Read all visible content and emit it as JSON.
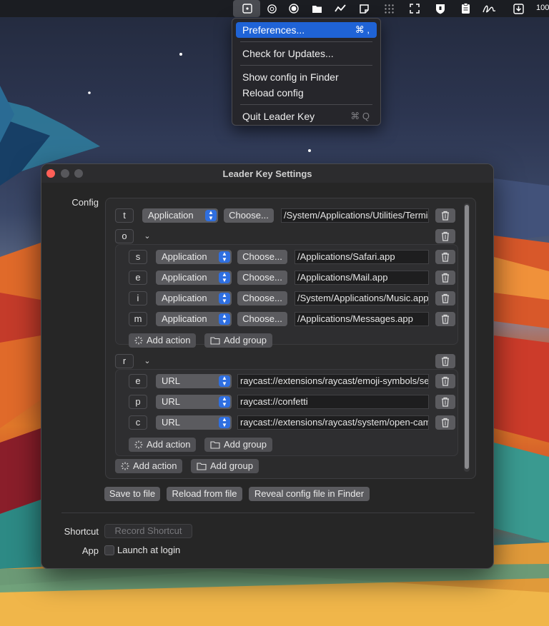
{
  "menubar": {
    "icons": [
      "leader-key-icon",
      "chatgpt-icon",
      "record-icon",
      "folder-icon",
      "activity-icon",
      "sticker-icon",
      "grid-icon",
      "fullscreen-icon",
      "shield-icon",
      "clipboard-icon",
      "signature-icon",
      "download-icon"
    ],
    "right_text": "100"
  },
  "menu": {
    "items": [
      {
        "label": "Preferences...",
        "shortcut": "⌘ ,"
      },
      {
        "label": "Check for Updates..."
      },
      {
        "label": "Show config in Finder"
      },
      {
        "label": "Reload config"
      },
      {
        "label": "Quit Leader Key",
        "shortcut": "⌘ Q"
      }
    ]
  },
  "window": {
    "title": "Leader Key Settings",
    "config_label": "Config",
    "shortcut_label": "Shortcut",
    "app_label": "App",
    "record_shortcut": "Record Shortcut",
    "launch_at_login": "Launch at login",
    "choose_label": "Choose...",
    "add_action": "Add action",
    "add_group": "Add group",
    "save_to_file": "Save to file",
    "reload_from_file": "Reload from file",
    "reveal_config": "Reveal config file in Finder"
  },
  "config": {
    "top_action": {
      "key": "t",
      "type": "Application",
      "path": "/System/Applications/Utilities/Terminal.app"
    },
    "group_o": {
      "key": "o",
      "actions": [
        {
          "key": "s",
          "type": "Application",
          "path": "/Applications/Safari.app"
        },
        {
          "key": "e",
          "type": "Application",
          "path": "/Applications/Mail.app"
        },
        {
          "key": "i",
          "type": "Application",
          "path": "/System/Applications/Music.app"
        },
        {
          "key": "m",
          "type": "Application",
          "path": "/Applications/Messages.app"
        }
      ]
    },
    "group_r": {
      "key": "r",
      "actions": [
        {
          "key": "e",
          "type": "URL",
          "path": "raycast://extensions/raycast/emoji-symbols/search-emoji-symbols"
        },
        {
          "key": "p",
          "type": "URL",
          "path": "raycast://confetti"
        },
        {
          "key": "c",
          "type": "URL",
          "path": "raycast://extensions/raycast/system/open-camera"
        }
      ]
    }
  },
  "colors": {
    "accent": "#1f63d6",
    "close": "#ff5f57",
    "window_bg": "#262626"
  }
}
